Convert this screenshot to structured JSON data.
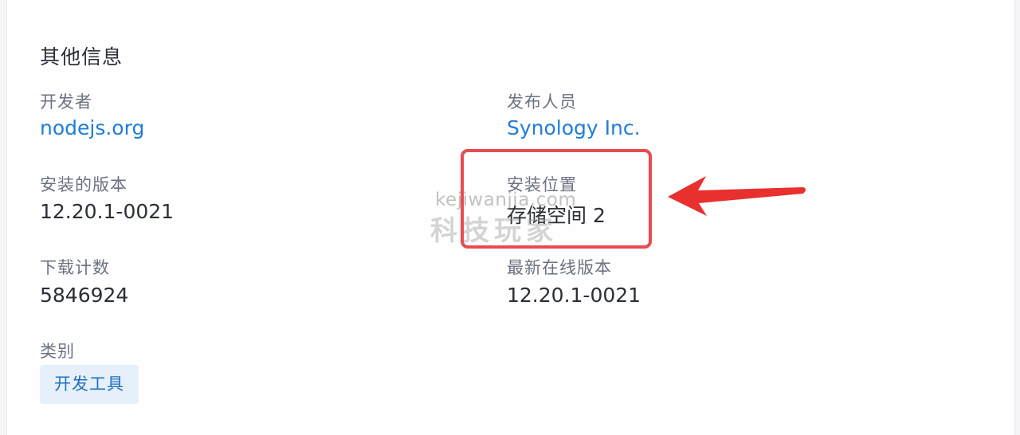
{
  "section": {
    "title": "其他信息"
  },
  "fields": {
    "developer": {
      "label": "开发者",
      "value": "nodejs.org"
    },
    "publisher": {
      "label": "发布人员",
      "value": "Synology Inc."
    },
    "installed_version": {
      "label": "安装的版本",
      "value": "12.20.1-0021"
    },
    "install_location": {
      "label": "安装位置",
      "value": "存储空间 2"
    },
    "download_count": {
      "label": "下载计数",
      "value": "5846924"
    },
    "latest_version": {
      "label": "最新在线版本",
      "value": "12.20.1-0021"
    },
    "category": {
      "label": "类别",
      "value": "开发工具"
    }
  },
  "watermark": {
    "line1": "kejiwanjia.com",
    "line2": "科技玩家"
  },
  "colors": {
    "link": "#1f7ed6",
    "highlight": "#e74c4f",
    "tag_bg": "#e6f0fb"
  }
}
